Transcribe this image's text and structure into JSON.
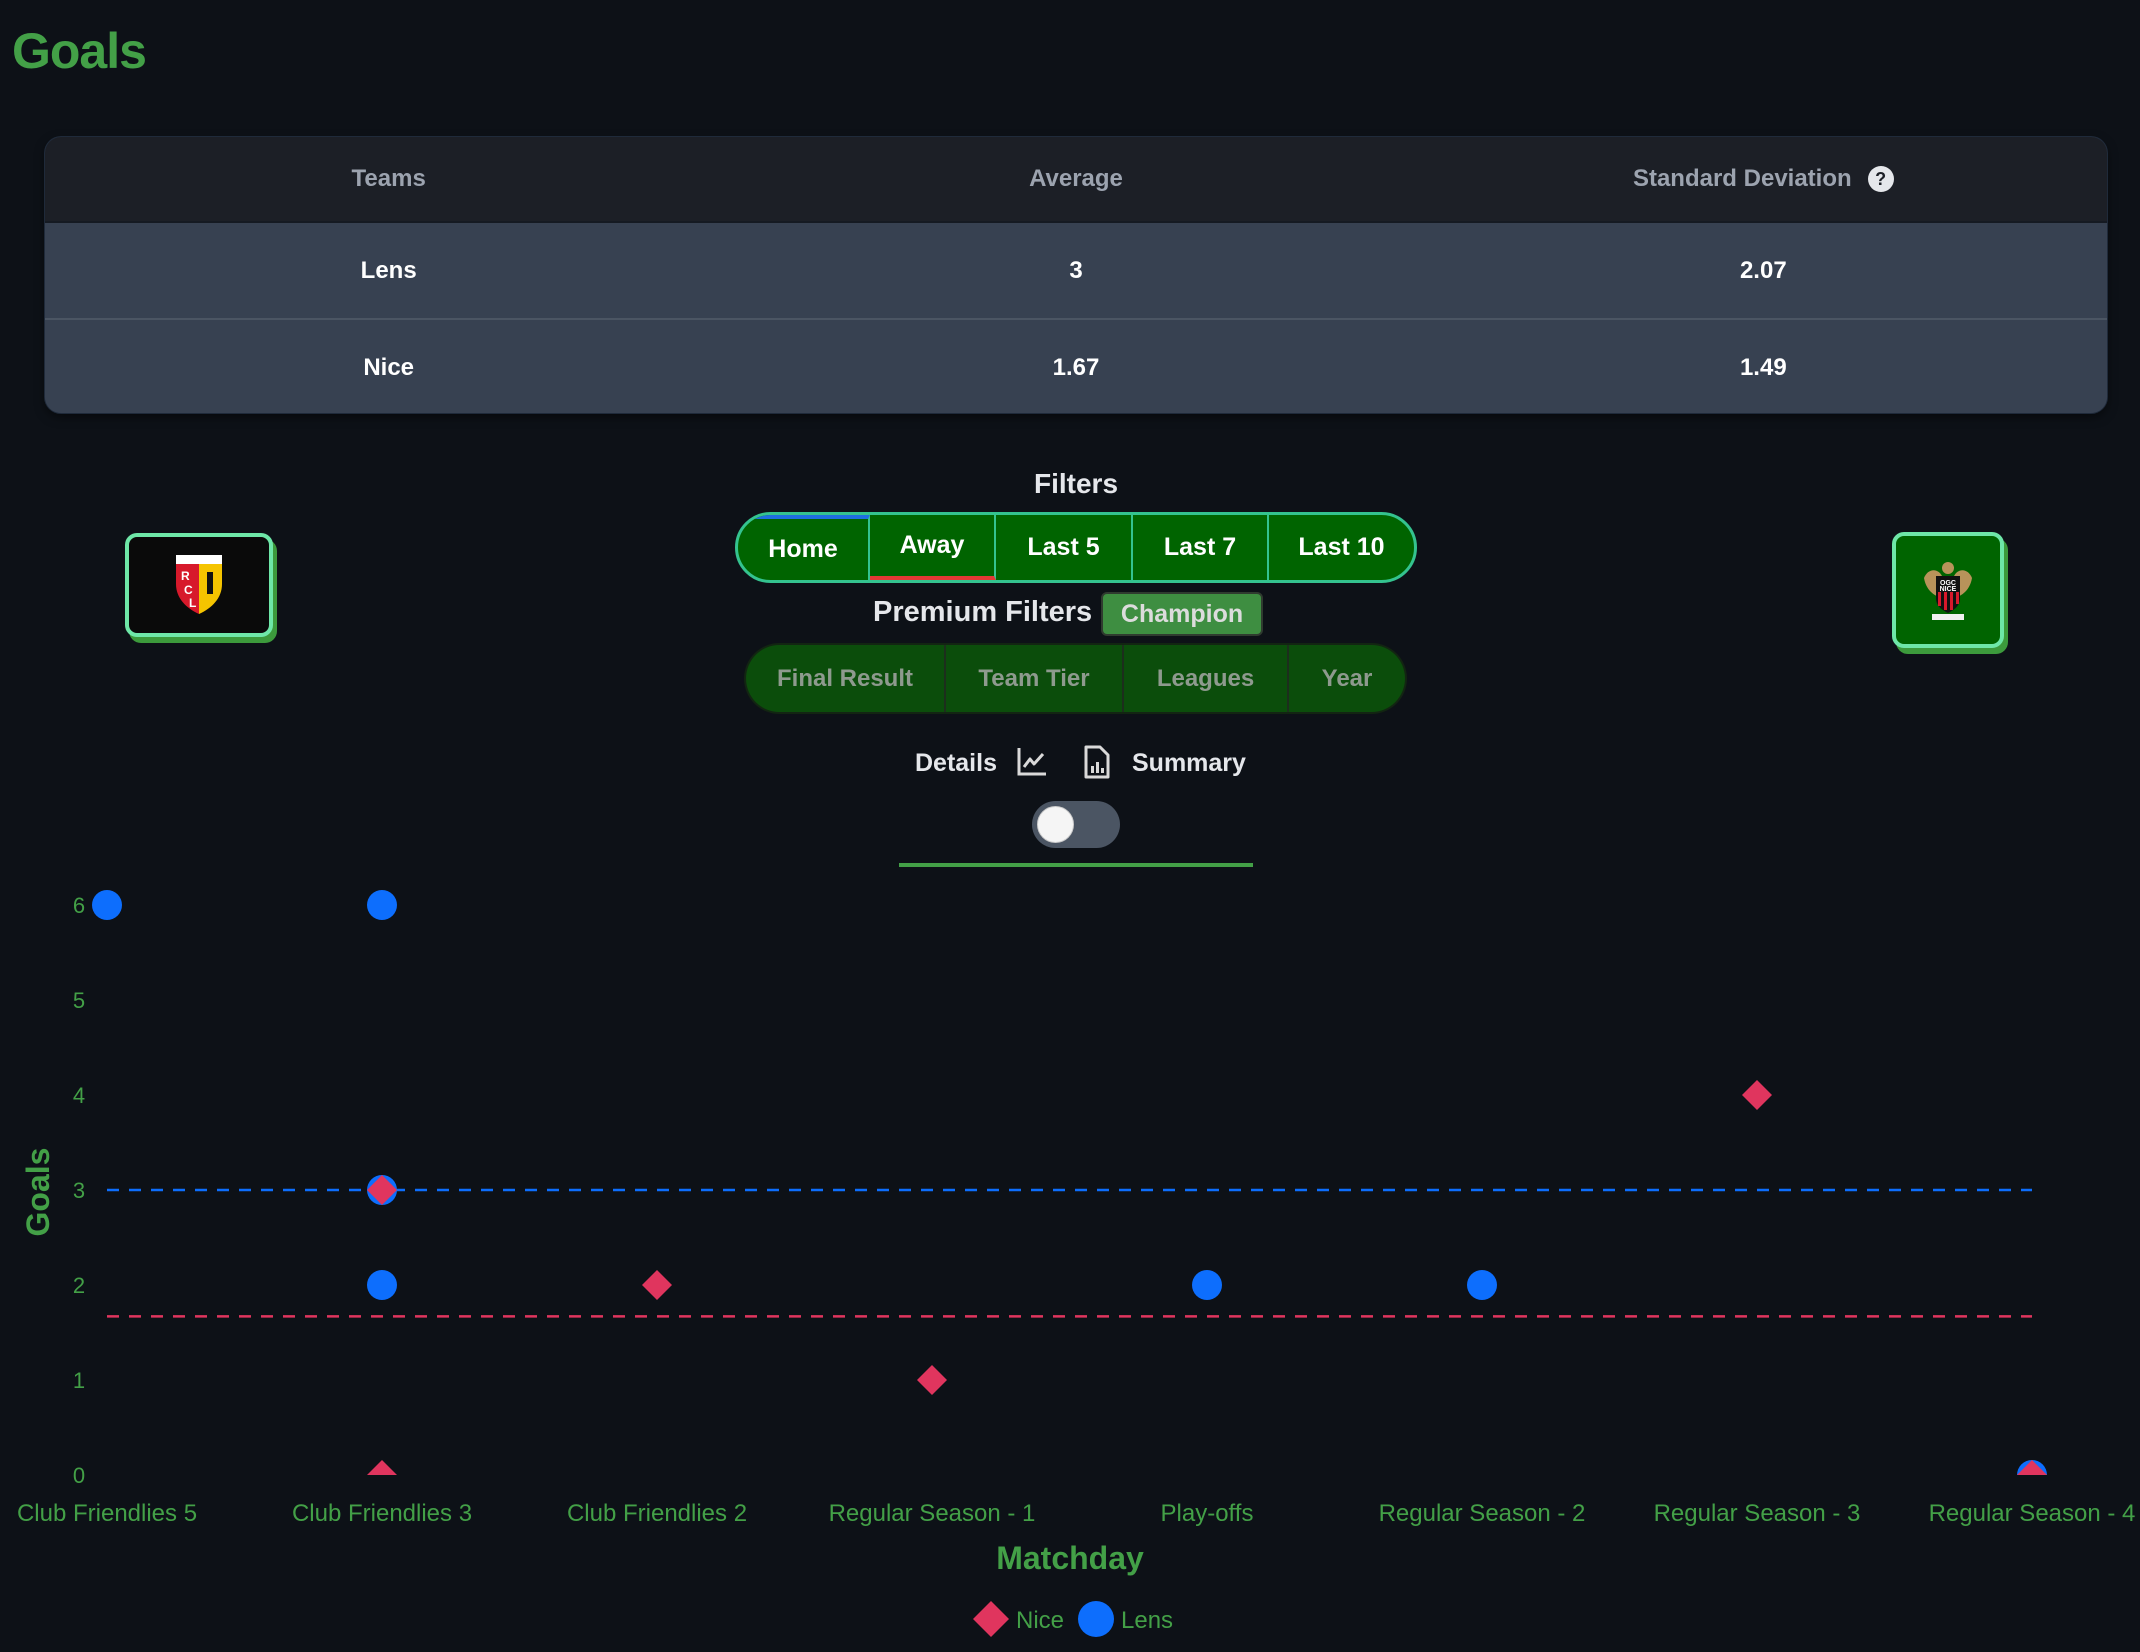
{
  "title": "Goals",
  "stats_table": {
    "headers": [
      "Teams",
      "Average",
      "Standard Deviation"
    ],
    "help_icon": "question-circle-icon",
    "rows": [
      {
        "team": "Lens",
        "average": "3",
        "std": "2.07"
      },
      {
        "team": "Nice",
        "average": "1.67",
        "std": "1.49"
      }
    ]
  },
  "filters": {
    "title": "Filters",
    "buttons": [
      "Home",
      "Away",
      "Last 5",
      "Last 7",
      "Last 10"
    ],
    "home_indicator_color": "#1e6fe0",
    "away_indicator_color": "#e53935"
  },
  "premium_filters": {
    "label": "Premium Filters",
    "badge": "Champion",
    "buttons": [
      "Final Result",
      "Team Tier",
      "Leagues",
      "Year"
    ]
  },
  "view_switch": {
    "details_label": "Details",
    "details_icon": "line-chart-icon",
    "summary_icon": "report-document-icon",
    "summary_label": "Summary",
    "toggle_on": false
  },
  "teams": {
    "home": {
      "name": "Lens",
      "logo_text": "RCL"
    },
    "away": {
      "name": "Nice",
      "logo_text": "OGC NICE"
    }
  },
  "colors": {
    "accent": "#43a047",
    "lens": "#0d6efd",
    "nice": "#e0355e",
    "background": "#0d1117"
  },
  "chart_data": {
    "type": "scatter",
    "title": "",
    "xlabel": "Matchday",
    "ylabel": "Goals",
    "categories": [
      "Club Friendlies 5",
      "Club Friendlies 3",
      "Club Friendlies 2",
      "Regular Season - 1",
      "Play-offs",
      "Regular Season - 2",
      "Regular Season - 3",
      "Regular Season - 4"
    ],
    "yticks": [
      0,
      1,
      2,
      3,
      4,
      5,
      6
    ],
    "ylim": [
      0,
      6
    ],
    "grid": false,
    "legend_position": "bottom-center",
    "series": [
      {
        "name": "Lens",
        "marker": "circle",
        "color": "#0d6efd",
        "points": [
          {
            "x": "Club Friendlies 5",
            "y": 6
          },
          {
            "x": "Club Friendlies 3",
            "y": 6
          },
          {
            "x": "Club Friendlies 3",
            "y": 3
          },
          {
            "x": "Club Friendlies 3",
            "y": 2
          },
          {
            "x": "Play-offs",
            "y": 2
          },
          {
            "x": "Regular Season - 2",
            "y": 2
          },
          {
            "x": "Regular Season - 4",
            "y": 0
          }
        ],
        "mean": 3
      },
      {
        "name": "Nice",
        "marker": "diamond",
        "color": "#e0355e",
        "points": [
          {
            "x": "Club Friendlies 3",
            "y": 3
          },
          {
            "x": "Club Friendlies 3",
            "y": 0
          },
          {
            "x": "Club Friendlies 2",
            "y": 2
          },
          {
            "x": "Regular Season - 1",
            "y": 1
          },
          {
            "x": "Regular Season - 3",
            "y": 4
          },
          {
            "x": "Regular Season - 4",
            "y": 0
          }
        ],
        "mean": 1.67
      }
    ],
    "legend": [
      "Nice",
      "Lens"
    ]
  }
}
